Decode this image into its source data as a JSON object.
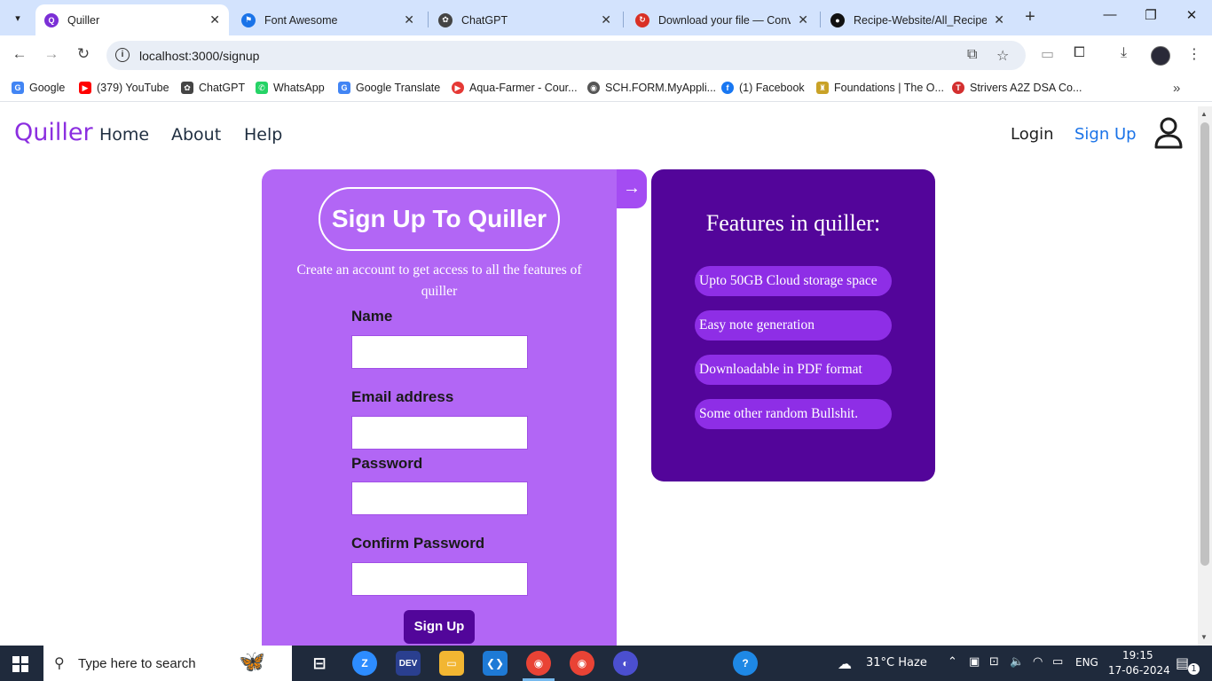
{
  "browser": {
    "tabs": [
      {
        "label": "Quiller",
        "fav_color": "#7b2fd6",
        "fav_text": "Q",
        "active": true
      },
      {
        "label": "Font Awesome",
        "fav_color": "#1a73e8",
        "fav_text": "⚑",
        "active": false
      },
      {
        "label": "ChatGPT",
        "fav_color": "#444",
        "fav_text": "✿",
        "active": false
      },
      {
        "label": "Download your file — Conve",
        "fav_color": "#d93025",
        "fav_text": "↻",
        "active": false
      },
      {
        "label": "Recipe-Website/All_Recipes",
        "fav_color": "#111",
        "fav_text": "●",
        "active": false
      }
    ],
    "url": "localhost:3000/signup",
    "bookmarks": [
      {
        "label": "Google",
        "icon": "google-icon",
        "color": "#4285f4",
        "glyph": "G"
      },
      {
        "label": "(379) YouTube",
        "icon": "youtube-icon",
        "color": "#ff0000",
        "glyph": "▶"
      },
      {
        "label": "ChatGPT",
        "icon": "chatgpt-icon",
        "color": "#444",
        "glyph": "✿"
      },
      {
        "label": "WhatsApp",
        "icon": "whatsapp-icon",
        "color": "#25d366",
        "glyph": "✆"
      },
      {
        "label": "Google Translate",
        "icon": "translate-icon",
        "color": "#4285f4",
        "glyph": "G"
      },
      {
        "label": "Aqua-Farmer - Cour...",
        "icon": "play-icon",
        "color": "#e53935",
        "glyph": "▶"
      },
      {
        "label": "SCH.FORM.MyAppli...",
        "icon": "globe-icon",
        "color": "#555",
        "glyph": "◉"
      },
      {
        "label": "(1) Facebook",
        "icon": "facebook-icon",
        "color": "#1877f2",
        "glyph": "f"
      },
      {
        "label": "Foundations | The O...",
        "icon": "odin-icon",
        "color": "#c9a227",
        "glyph": "♜"
      },
      {
        "label": "Strivers A2Z DSA Co...",
        "icon": "tuf-icon",
        "color": "#d32f2f",
        "glyph": "T"
      }
    ]
  },
  "site": {
    "brand": "Quiller",
    "nav": [
      "Home",
      "About",
      "Help"
    ],
    "login": "Login",
    "signup": "Sign Up"
  },
  "signup_form": {
    "title": "Sign Up To Quiller",
    "subtitle": "Create an account to get access to all the features of quiller",
    "fields": [
      {
        "label": "Name",
        "value": ""
      },
      {
        "label": "Email address",
        "value": ""
      },
      {
        "label": "Password",
        "value": ""
      },
      {
        "label": "Confirm Password",
        "value": ""
      }
    ],
    "submit": "Sign Up",
    "arrow": "→"
  },
  "features": {
    "title": "Features in quiller:",
    "items": [
      "Upto 50GB Cloud storage space",
      "Easy note generation",
      "Downloadable in PDF format",
      "Some other random Bullshit."
    ]
  },
  "taskbar": {
    "search_placeholder": "Type here to search",
    "weather": "31°C  Haze",
    "lang": "ENG",
    "time": "19:15",
    "date": "17-06-2024",
    "notification_count": "1"
  },
  "colors": {
    "brand": "#8b2ee0",
    "card_light": "#b266f5",
    "card_dark": "#53059a",
    "button": "#52069a",
    "link_active": "#1a73e8"
  }
}
